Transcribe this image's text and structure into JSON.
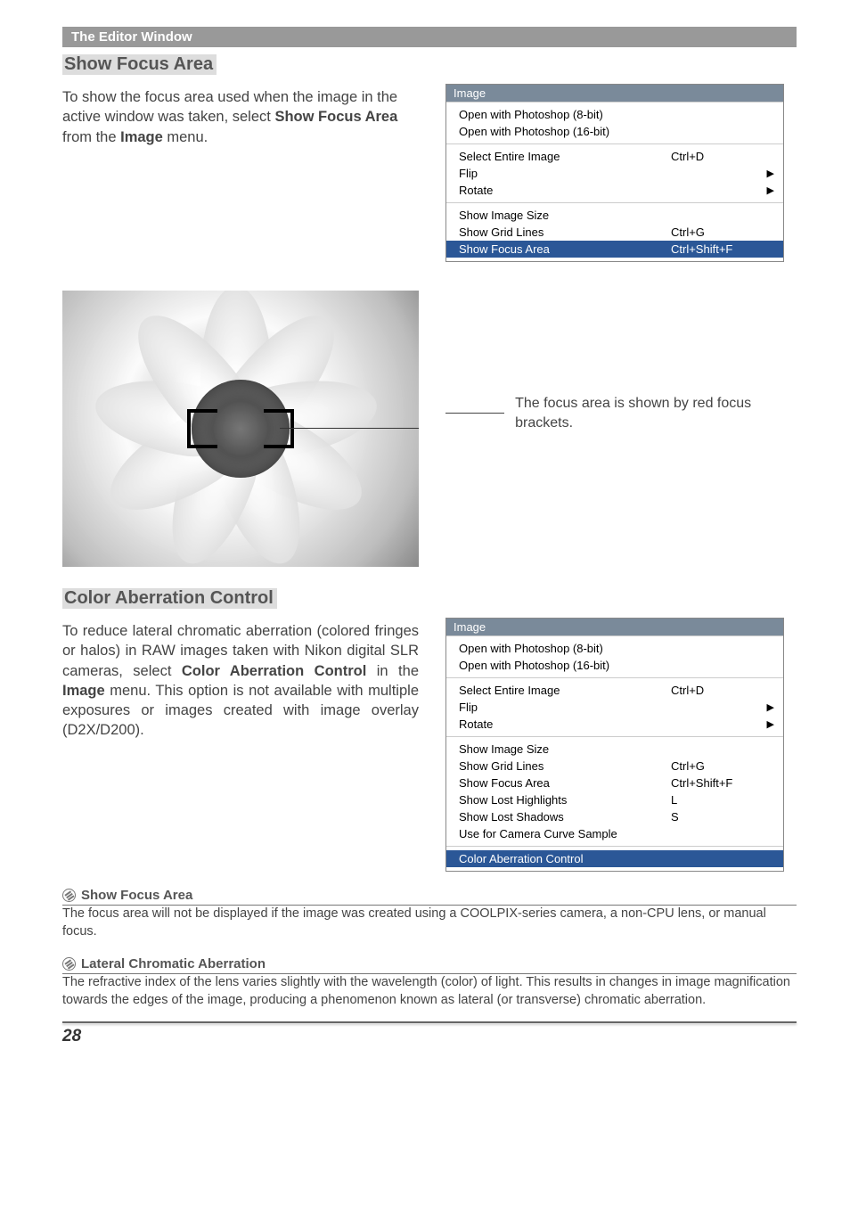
{
  "header": "The Editor Window",
  "section1": {
    "title": "Show Focus Area",
    "body_prefix": "To show the focus area used when the image in the active window was taken, select ",
    "body_bold1": "Show Focus Area",
    "body_mid": " from the ",
    "body_bold2": "Image",
    "body_suffix": " menu."
  },
  "menu1": {
    "title": "Image",
    "group1": [
      {
        "label": "Open with Photoshop (8-bit)",
        "shortcut": "",
        "arrow": ""
      },
      {
        "label": "Open with Photoshop (16-bit)",
        "shortcut": "",
        "arrow": ""
      }
    ],
    "group2": [
      {
        "label": "Select Entire Image",
        "shortcut": "Ctrl+D",
        "arrow": ""
      },
      {
        "label": "Flip",
        "shortcut": "",
        "arrow": "▶"
      },
      {
        "label": "Rotate",
        "shortcut": "",
        "arrow": "▶"
      }
    ],
    "group3": [
      {
        "label": "Show Image Size",
        "shortcut": "",
        "arrow": ""
      },
      {
        "label": "Show Grid Lines",
        "shortcut": "Ctrl+G",
        "arrow": ""
      },
      {
        "label": "Show Focus Area",
        "shortcut": "Ctrl+Shift+F",
        "arrow": "",
        "highlight": true
      }
    ]
  },
  "caption1": "The focus area is shown by red focus brackets.",
  "section2": {
    "title": "Color Aberration Control",
    "body_prefix": "To reduce lateral chromatic aberration (colored fringes or halos) in RAW images taken with Nikon digital SLR cameras, select ",
    "body_bold1": "Color Aberration Control",
    "body_mid": " in the ",
    "body_bold2": "Image",
    "body_suffix": " menu. This option is not available with multiple exposures or images created with image overlay (D2X/D200)."
  },
  "menu2": {
    "title": "Image",
    "group1": [
      {
        "label": "Open with Photoshop (8-bit)",
        "shortcut": "",
        "arrow": ""
      },
      {
        "label": "Open with Photoshop (16-bit)",
        "shortcut": "",
        "arrow": ""
      }
    ],
    "group2": [
      {
        "label": "Select Entire Image",
        "shortcut": "Ctrl+D",
        "arrow": ""
      },
      {
        "label": "Flip",
        "shortcut": "",
        "arrow": "▶"
      },
      {
        "label": "Rotate",
        "shortcut": "",
        "arrow": "▶"
      }
    ],
    "group3": [
      {
        "label": "Show Image Size",
        "shortcut": "",
        "arrow": ""
      },
      {
        "label": "Show Grid Lines",
        "shortcut": "Ctrl+G",
        "arrow": ""
      },
      {
        "label": "Show Focus Area",
        "shortcut": "Ctrl+Shift+F",
        "arrow": ""
      },
      {
        "label": "Show Lost Highlights",
        "shortcut": "L",
        "arrow": ""
      },
      {
        "label": "Show Lost Shadows",
        "shortcut": "S",
        "arrow": ""
      },
      {
        "label": "Use for Camera Curve Sample",
        "shortcut": "",
        "arrow": ""
      }
    ],
    "group4": [
      {
        "label": "Color Aberration Control",
        "shortcut": "",
        "arrow": "",
        "highlight": true
      }
    ]
  },
  "note1": {
    "title": "Show Focus Area",
    "body": "The focus area will not be displayed if the image was created using a COOLPIX-series camera, a non-CPU lens, or manual focus."
  },
  "note2": {
    "title": "Lateral Chromatic Aberration",
    "body": "The refractive index of the lens varies slightly with the wavelength (color) of light.  This results in changes in image magnification towards the edges of the image, producing a phenomenon known as lateral (or transverse) chromatic aberration."
  },
  "page_number": "28"
}
